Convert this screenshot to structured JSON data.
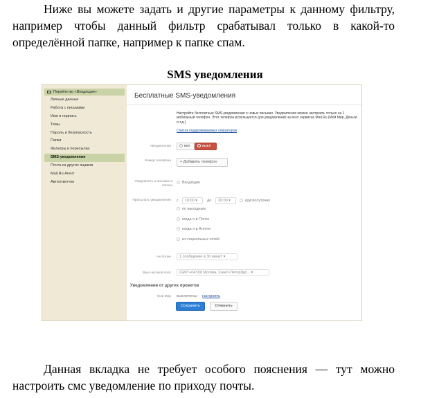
{
  "doc": {
    "paragraph1": "Ниже вы можете задать и другие параметры к данному фильтру, например чтобы данный фильтр срабатывал только в какой-то определённой папке, например к папке спам.",
    "heading": "SMS уведомления",
    "paragraph2": "Данная вкладка не требует особого пояснения — тут можно настроить смс уведомление по приходу почты."
  },
  "screenshot": {
    "sidebar": {
      "back_label": "Перейти во «Входящие»",
      "items": [
        {
          "label": "Личные данные"
        },
        {
          "label": "Работа с письмами"
        },
        {
          "label": "Имя и подпись"
        },
        {
          "label": "Темы"
        },
        {
          "label": "Пароль и безопасность"
        },
        {
          "label": "Папки"
        },
        {
          "label": "Фильтры и пересылка"
        },
        {
          "label": "SMS-уведомления",
          "active": true
        },
        {
          "label": "Почта из других ящиков"
        },
        {
          "label": "Mail.Ru Агент"
        },
        {
          "label": "Автоответчик"
        }
      ]
    },
    "main": {
      "title": "Бесплатные SMS-уведомления",
      "intro": "Настройте бесплатные SMS-уведомления о новых письмах. Уведомления можно настроить только на 1 мобильный телефон. Этот телефон используется для уведомлений на всех сервисах Mail.Ru (Мой Мир, Деньги и т.д.)",
      "operators_link": "Список поддерживаемых операторов",
      "notifications": {
        "label": "Уведомления",
        "on": "вкл",
        "off": "выкл"
      },
      "phone": {
        "label": "Номер телефона",
        "add_button": "+ Добавить телефон"
      },
      "notify_about": {
        "label": "Уведомлять о письмах в папках",
        "value": "Входящие"
      },
      "send_time": {
        "label": "Присылать уведомления",
        "from_prefix": "с",
        "from": "10:00",
        "to_prefix": "до",
        "to": "20:00",
        "all_day": "круглосуточно",
        "options": [
          "по выходным",
          "когда я в Почте",
          "когда я в Агенте",
          "из социальных сетей"
        ]
      },
      "limit": {
        "label": "Не более",
        "value": "1 сообщение в 30 минут"
      },
      "timezone": {
        "label": "Ваш часовой пояс",
        "value": "(GMT+04:00) Москва, Санкт-Петербур..."
      },
      "other_projects": {
        "heading": "Уведомления от других проектов",
        "label": "Мой Мир",
        "status": "выключены",
        "configure": "настроить"
      },
      "save_button": "Сохранить",
      "cancel_button": "Отменить"
    }
  },
  "colors": {
    "sidebar_bg": "#efe9d6",
    "active_item": "#c9d3a6",
    "save_blue": "#2d7fd5",
    "off_red": "#c95040"
  }
}
